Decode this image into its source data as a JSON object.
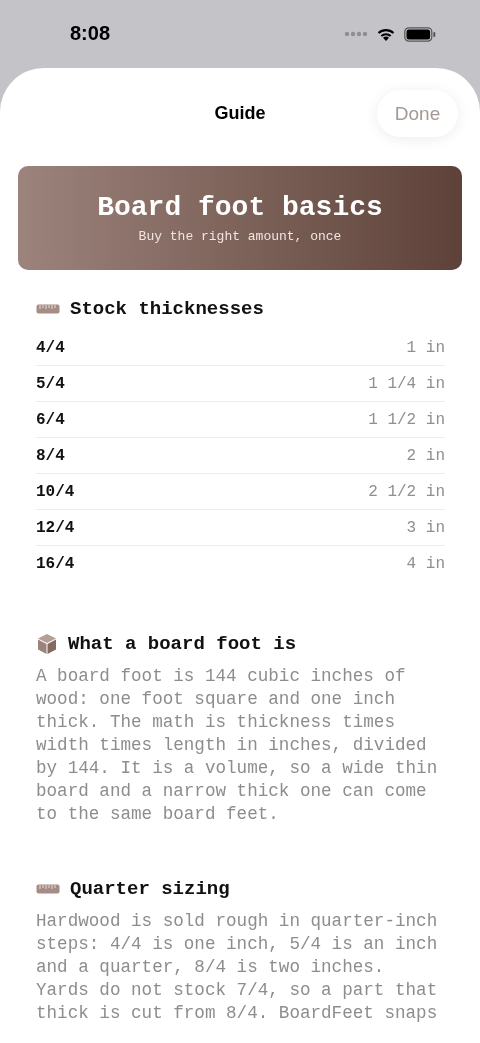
{
  "status_bar": {
    "time": "8:08"
  },
  "nav": {
    "title": "Guide",
    "done": "Done"
  },
  "banner": {
    "title": "Board foot basics",
    "subtitle": "Buy the right amount, once"
  },
  "sections": [
    {
      "kind": "table",
      "title": "Stock thicknesses",
      "rows": [
        {
          "label": "4/4",
          "value": "1 in"
        },
        {
          "label": "5/4",
          "value": "1 1/4 in"
        },
        {
          "label": "6/4",
          "value": "1 1/2 in"
        },
        {
          "label": "8/4",
          "value": "2 in"
        },
        {
          "label": "10/4",
          "value": "2 1/2 in"
        },
        {
          "label": "12/4",
          "value": "3 in"
        },
        {
          "label": "16/4",
          "value": "4 in"
        }
      ]
    },
    {
      "kind": "text",
      "title": "What a board foot is",
      "body": "A board foot is 144 cubic inches of wood: one foot square and one inch thick. The math is thickness times width times length in inches, divided by 144. It is a volume, so a wide thin board and a narrow thick one can come to the same board feet."
    },
    {
      "kind": "text",
      "title": "Quarter sizing",
      "body": "Hardwood is sold rough in quarter-inch steps: 4/4 is one inch, 5/4 is an inch and a quarter, 8/4 is two inches. Yards do not stock 7/4, so a part that thick is cut from 8/4. BoardFeet snaps"
    }
  ]
}
